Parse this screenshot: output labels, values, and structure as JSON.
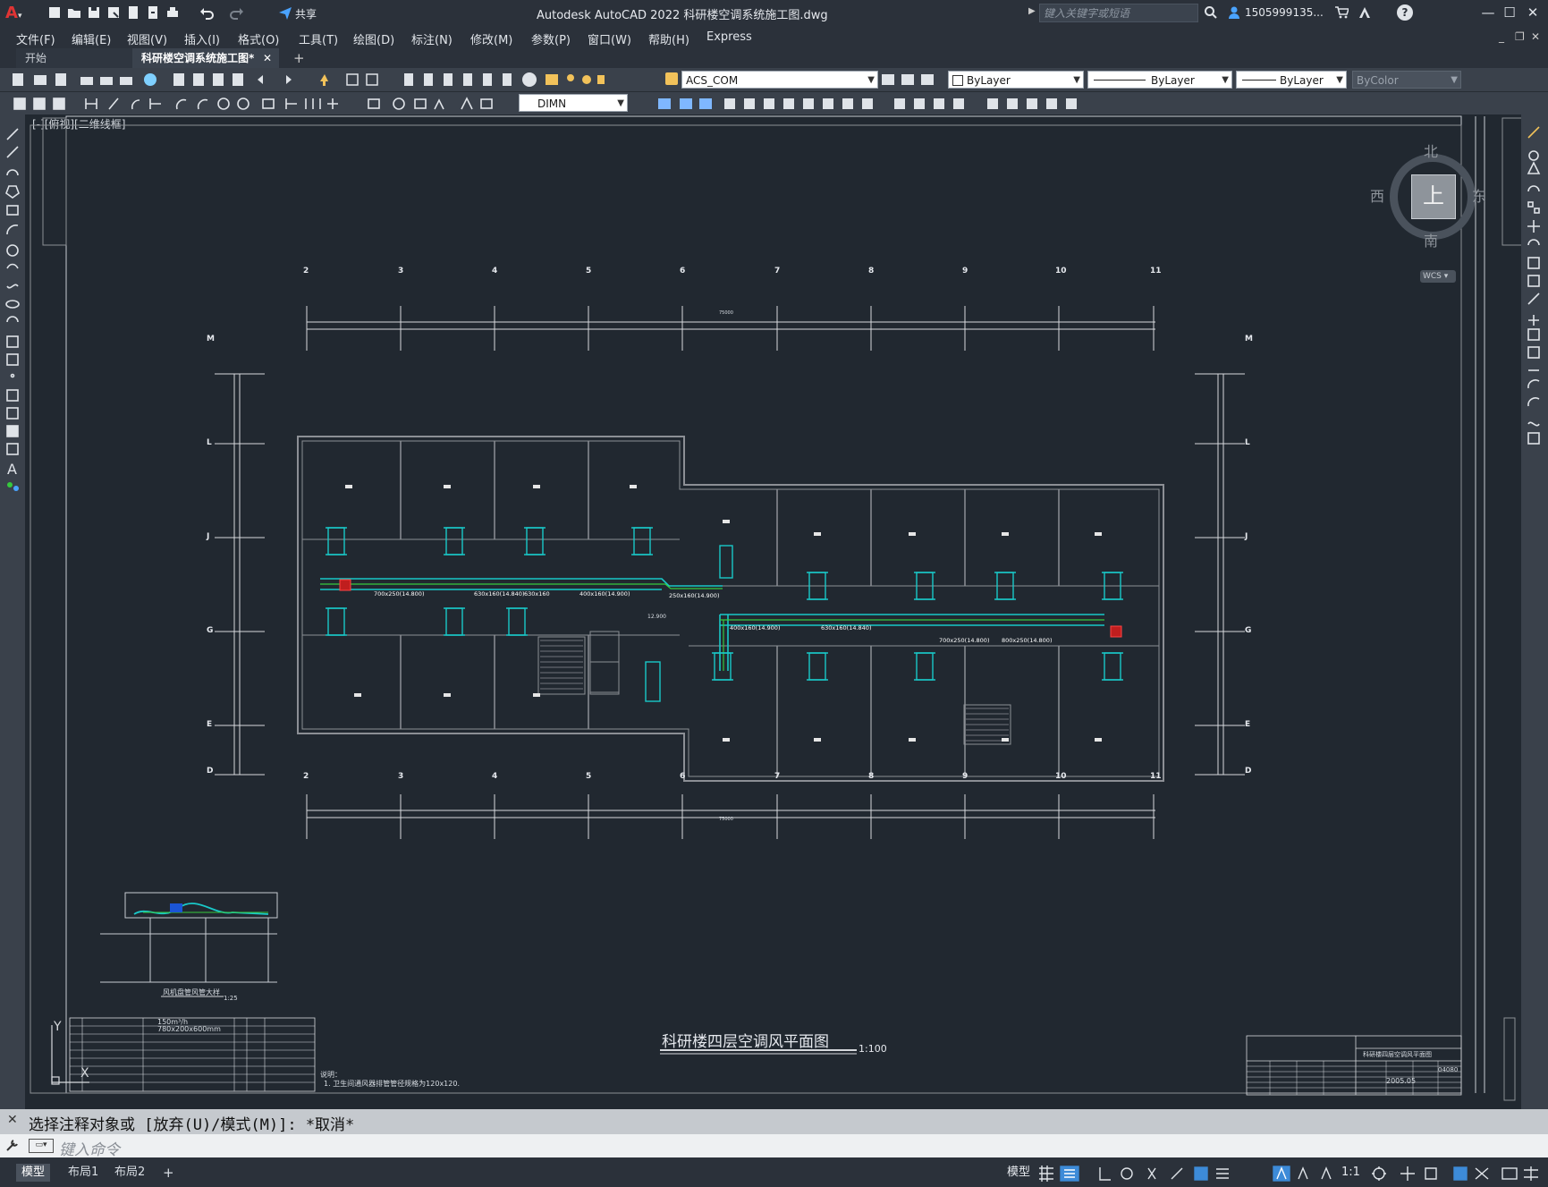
{
  "app": {
    "title": "Autodesk AutoCAD 2022    科研楼空调系统施工图.dwg",
    "share_label": "共享",
    "search_placeholder": "键入关键字或短语",
    "user": "1505999135...",
    "window_controls": [
      "minimize-icon",
      "maximize-icon",
      "close-icon"
    ]
  },
  "menu": [
    "文件(F)",
    "编辑(E)",
    "视图(V)",
    "插入(I)",
    "格式(O)",
    "工具(T)",
    "绘图(D)",
    "标注(N)",
    "修改(M)",
    "参数(P)",
    "窗口(W)",
    "帮助(H)",
    "Express"
  ],
  "tabs": [
    {
      "label": "开始",
      "active": false
    },
    {
      "label": "科研楼空调系统施工图*",
      "active": true
    }
  ],
  "toolbar": {
    "layer_value": "ACS_COM",
    "color_value": "ByLayer",
    "linetype_value": "ByLayer",
    "lineweight_value": "ByLayer",
    "plotstyle_value": "ByColor",
    "dimstyle_value": "DIMN"
  },
  "viewport": {
    "label": "[-][俯视][二维线框]",
    "viewcube": {
      "north": "北",
      "south": "南",
      "east": "东",
      "west": "西",
      "face": "上",
      "ucs": "WCS"
    }
  },
  "drawing": {
    "title": "科研楼四层空调风平面图",
    "scale": "1:100",
    "detail_title": "风机盘管风管大样",
    "detail_scale": "1:25",
    "grid_cols": [
      "2",
      "3",
      "4",
      "5",
      "6",
      "7",
      "8",
      "9",
      "10",
      "11"
    ],
    "grid_rows_left": [
      "M",
      "L",
      "J",
      "G",
      "E",
      "D"
    ],
    "total_dim": "75000",
    "note_header": "说明：",
    "note_text": "1.  卫生间通风器排管管径规格为120x120.",
    "legend_spec_1": "150m³/h",
    "legend_spec_2": "780x200x600mm",
    "duct_labels": [
      "700x250(14.800)",
      "630x160(14.840)",
      "630x160",
      "400x160(14.900)",
      "250x160(14.900)",
      "400x160(14.900)",
      "630x160(14.840)",
      "700x250(14.800)",
      "800x250(14.800)"
    ],
    "level_label": "12.900",
    "titleblock_name": "科研楼四层空调风平面图",
    "titleblock_date": "2005.05",
    "titleblock_no": "04080"
  },
  "command": {
    "history": "选择注释对象或 [放弃(U)/模式(M)]: *取消*",
    "placeholder": "键入命令"
  },
  "status": {
    "layout_tabs": [
      "模型",
      "布局1",
      "布局2"
    ],
    "model_label": "模型",
    "annot_scale": "1:1"
  },
  "colors": {
    "accent": "#3d8bd8",
    "canvas": "#212830",
    "duct": "#19c8c8",
    "duct_center": "#36c93d",
    "wall": "#8c8f95"
  }
}
